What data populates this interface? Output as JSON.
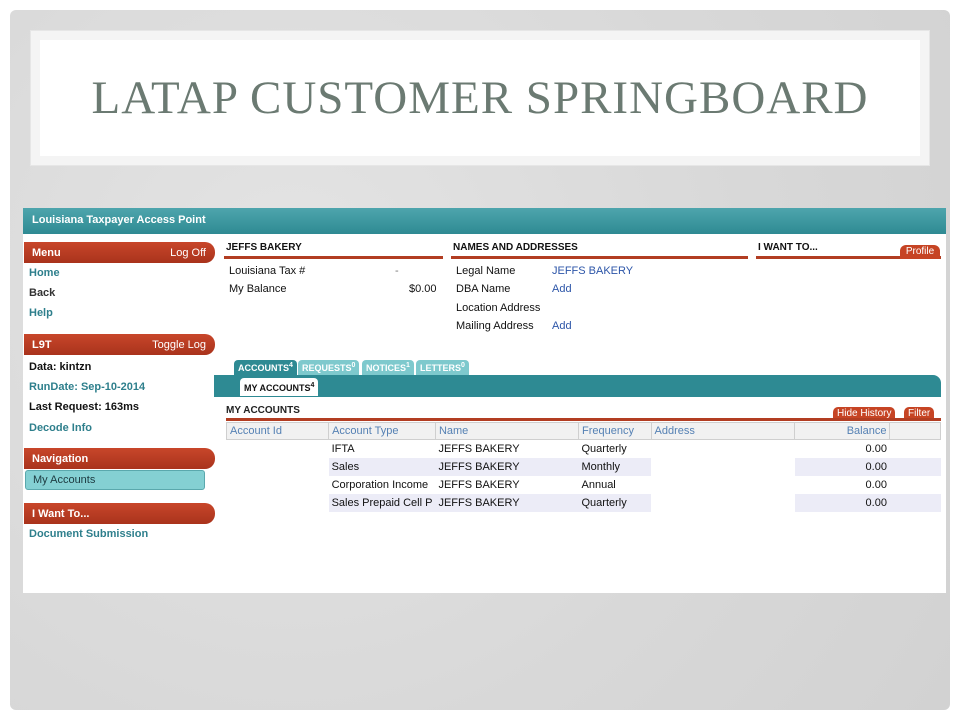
{
  "slide": {
    "title": "LATAP CUSTOMER SPRINGBOARD"
  },
  "app": {
    "title": "Louisiana Taxpayer Access Point"
  },
  "sidebar": {
    "menu": {
      "title": "Menu",
      "action": "Log Off",
      "links": [
        "Home",
        "Back",
        "Help"
      ]
    },
    "lst": {
      "title": "L9T",
      "action": "Toggle Log",
      "data_label": "Data: kintzn",
      "rundate": "RunDate: Sep-10-2014",
      "last_request": "Last Request: 163ms",
      "decode": "Decode Info"
    },
    "navigation": {
      "title": "Navigation",
      "item": "My Accounts"
    },
    "iwant": {
      "title": "I Want To...",
      "link": "Document Submission"
    }
  },
  "taxpayer": {
    "header": "JEFFS BAKERY",
    "tax_label": "Louisiana Tax #",
    "tax_value": "-",
    "balance_label": "My Balance",
    "balance_value": "$0.00"
  },
  "names": {
    "header": "NAMES AND ADDRESSES",
    "legal_label": "Legal Name",
    "legal_value": "JEFFS BAKERY",
    "dba_label": "DBA Name",
    "dba_value": "Add",
    "location_label": "Location Address",
    "mailing_label": "Mailing Address",
    "mailing_value": "Add"
  },
  "iwant_header": {
    "label": "I WANT TO...",
    "profile": "Profile"
  },
  "tabs": [
    {
      "label": "ACCOUNTS",
      "count": "4"
    },
    {
      "label": "REQUESTS",
      "count": "0"
    },
    {
      "label": "NOTICES",
      "count": "1"
    },
    {
      "label": "LETTERS",
      "count": "0"
    }
  ],
  "subtab": {
    "label": "MY ACCOUNTS",
    "count": "4"
  },
  "accounts": {
    "title": "MY ACCOUNTS",
    "hide_history": "Hide History",
    "filter": "Filter",
    "columns": [
      "Account Id",
      "Account Type",
      "Name",
      "Frequency",
      "Address",
      "Balance"
    ],
    "rows": [
      {
        "type": "IFTA",
        "name": "JEFFS BAKERY",
        "freq": "Quarterly",
        "balance": "0.00"
      },
      {
        "type": "Sales",
        "name": "JEFFS BAKERY",
        "freq": "Monthly",
        "balance": "0.00"
      },
      {
        "type": "Corporation Income",
        "name": "JEFFS BAKERY",
        "freq": "Annual",
        "balance": "0.00"
      },
      {
        "type": "Sales Prepaid Cell P",
        "name": "JEFFS BAKERY",
        "freq": "Quarterly",
        "balance": "0.00"
      }
    ]
  },
  "colors": {
    "accent_teal": "#2e8a93",
    "accent_red": "#b23d22",
    "title_gray": "#6b7a72"
  }
}
